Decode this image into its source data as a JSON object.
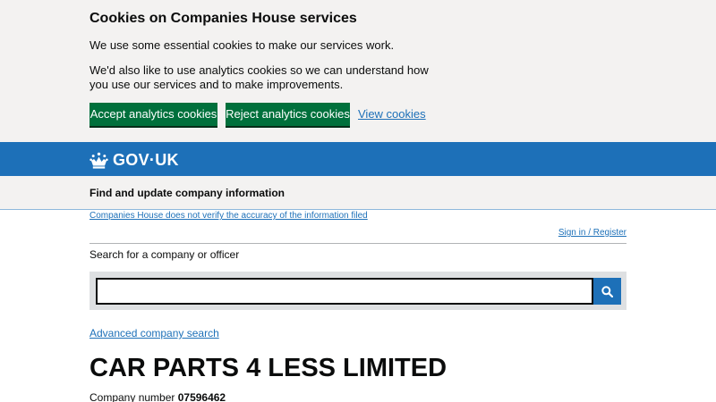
{
  "cookie_banner": {
    "title": "Cookies on Companies House services",
    "paragraph1": "We use some essential cookies to make our services work.",
    "paragraph2": "We'd also like to use analytics cookies so we can understand how you use our services and to make improvements.",
    "accept_label": "Accept analytics cookies",
    "reject_label": "Reject analytics cookies",
    "view_label": "View cookies",
    "button_color": "#00703c"
  },
  "header": {
    "logo_text": "GOV·UK",
    "logo_icon": "crown-icon",
    "brand_color": "#1d70b8"
  },
  "service": {
    "name": "Find and update company information"
  },
  "disclaimer": "Companies House does not verify the accuracy of the information filed",
  "account": {
    "sign_in_label": "Sign in / Register"
  },
  "search": {
    "label": "Search for a company or officer",
    "value": "",
    "button_icon": "search-icon"
  },
  "advanced_search_label": "Advanced company search",
  "company": {
    "name": "CAR PARTS 4 LESS LIMITED",
    "number_label": "Company number",
    "number": "07596462"
  }
}
